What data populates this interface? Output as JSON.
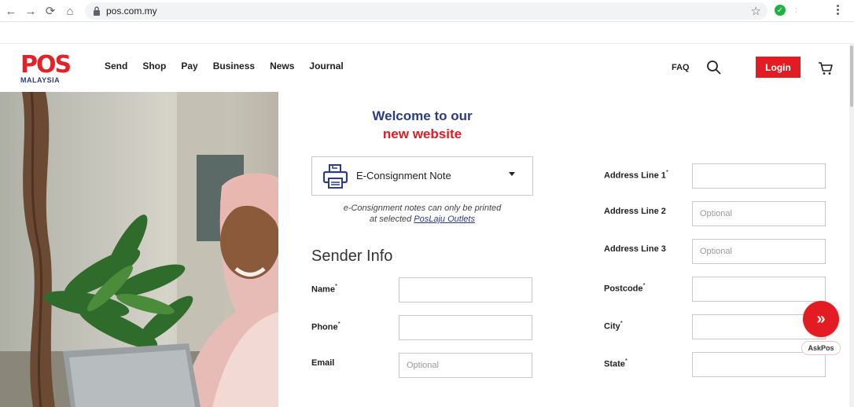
{
  "browser": {
    "url": "pos.com.my",
    "back_glyph": "←",
    "forward_glyph": "→",
    "reload_glyph": "⟳",
    "home_glyph": "⌂",
    "star_glyph": "☆",
    "ext_glyph": "✓"
  },
  "header": {
    "logo_text": "POS",
    "logo_sub": "MALAYSIA",
    "nav": [
      "Send",
      "Shop",
      "Pay",
      "Business",
      "News",
      "Journal"
    ],
    "faq": "FAQ",
    "login": "Login"
  },
  "welcome": {
    "line1": "Welcome to our",
    "line2": "new website"
  },
  "econsignment": {
    "label": "E-Consignment Note",
    "note_line1": "e-Consignment notes can only be printed",
    "note_line2_prefix": "at selected ",
    "note_link": "PosLaju Outlets"
  },
  "sender": {
    "title": "Sender Info",
    "fields": [
      {
        "label": "Name",
        "required": true,
        "value": "",
        "placeholder": ""
      },
      {
        "label": "Phone",
        "required": true,
        "value": "",
        "placeholder": ""
      },
      {
        "label": "Email",
        "required": false,
        "value": "",
        "placeholder": "Optional"
      }
    ]
  },
  "address": {
    "fields": [
      {
        "label": "Address Line 1",
        "required": true,
        "value": "",
        "placeholder": ""
      },
      {
        "label": "Address Line 2",
        "required": false,
        "value": "",
        "placeholder": "Optional"
      },
      {
        "label": "Address Line 3",
        "required": false,
        "value": "",
        "placeholder": "Optional"
      },
      {
        "label": "Postcode",
        "required": true,
        "value": "",
        "placeholder": ""
      },
      {
        "label": "City",
        "required": true,
        "value": "",
        "placeholder": ""
      },
      {
        "label": "State",
        "required": true,
        "value": "",
        "placeholder": ""
      }
    ]
  },
  "askpos": {
    "glyph": "»",
    "label": "AskPos"
  },
  "colors": {
    "brand_red": "#e31b23",
    "brand_navy": "#2c3c85"
  }
}
